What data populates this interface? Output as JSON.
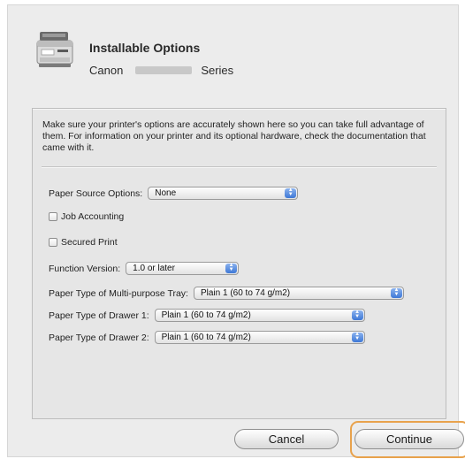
{
  "dialog": {
    "title": "Installable Options",
    "brand": "Canon",
    "series": "Series",
    "description": "Make sure your printer's options are accurately shown here so you can take full advantage of them.  For information on your printer and its optional hardware, check the documentation that came with it.",
    "printer_icon": "printer-icon"
  },
  "options": {
    "paper_source": {
      "label": "Paper Source Options:",
      "value": "None"
    },
    "job_accounting": {
      "label": "Job Accounting",
      "checked": false
    },
    "secured_print": {
      "label": "Secured Print",
      "checked": false
    },
    "function_version": {
      "label": "Function Version:",
      "value": "1.0 or later"
    },
    "multi_purpose_tray": {
      "label": "Paper Type of Multi-purpose Tray:",
      "value": "Plain 1 (60 to 74 g/m2)"
    },
    "drawer1": {
      "label": "Paper Type of Drawer 1:",
      "value": "Plain 1 (60 to 74 g/m2)"
    },
    "drawer2": {
      "label": "Paper Type of Drawer 2:",
      "value": "Plain 1 (60 to 74 g/m2)"
    }
  },
  "buttons": {
    "cancel": "Cancel",
    "continue": "Continue"
  },
  "colors": {
    "highlight_ring": "#e8a24c",
    "popup_arrow": "#3e78d6"
  }
}
